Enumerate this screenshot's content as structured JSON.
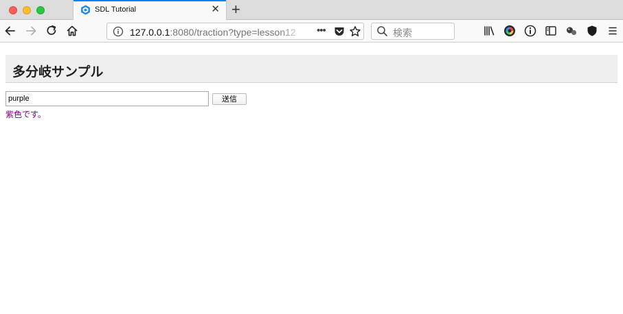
{
  "browser": {
    "tab": {
      "title": "SDL Tutorial",
      "close_glyph": "✕",
      "favicon": "sdl-logo-icon"
    },
    "new_tab_glyph": "+",
    "url": {
      "host": "127.0.0.1",
      "rest": ":8080/traction?type=lesson12",
      "more_glyph": "•••"
    },
    "search": {
      "placeholder": "検索"
    },
    "accent_color": "#0a84ff"
  },
  "page": {
    "heading": "多分岐サンプル",
    "input_value": "purple",
    "submit_label": "送信",
    "result": "紫色です。",
    "result_color": "#800080",
    "header_bg": "#efefef"
  }
}
